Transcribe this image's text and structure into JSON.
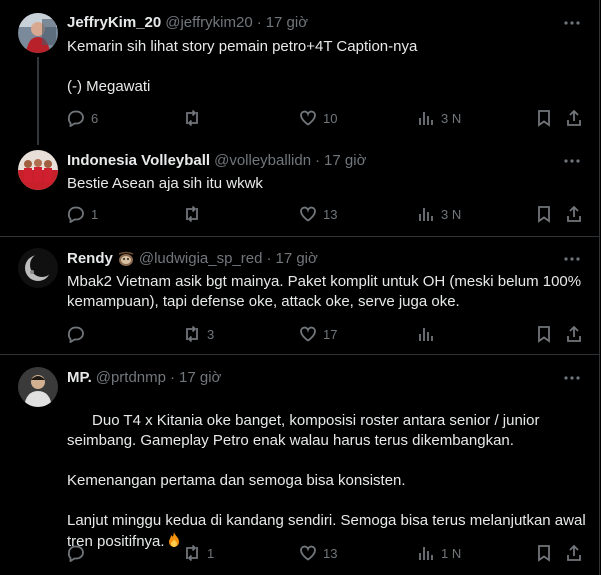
{
  "tweets": [
    {
      "name": "JeffryKim_20",
      "handle": "@jeffrykim20",
      "time": "17 giờ",
      "text": "Kemarin sih lihat story pemain petro+4T Caption-nya\n\n(-) Megawati",
      "replies": "6",
      "reposts": "",
      "likes": "10",
      "views": "3 N"
    },
    {
      "name": "Indonesia Volleyball",
      "handle": "@volleyballidn",
      "time": "17 giờ",
      "text": "Bestie Asean aja sih itu wkwk",
      "replies": "1",
      "reposts": "",
      "likes": "13",
      "views": "3 N"
    },
    {
      "name": "Rendy",
      "handle": "@ludwigia_sp_red",
      "time": "17 giờ",
      "text": "Mbak2 Vietnam asik bgt mainya. Paket komplit untuk OH (meski belum 100% kemampuan), tapi defense oke, attack oke, serve juga oke.",
      "replies": "",
      "reposts": "3",
      "likes": "17",
      "views": ""
    },
    {
      "name": "MP.",
      "handle": "@prtdnmp",
      "time": "17 giờ",
      "text": "Duo T4 x Kitania oke banget, komposisi roster antara senior / junior seimbang. Gameplay Petro enak walau harus terus dikembangkan.\n\nKemenangan pertama dan semoga bisa konsisten.\n\nLanjut minggu kedua di kandang sendiri. Semoga bisa terus melanjutkan awal tren positifnya.",
      "replies": "",
      "reposts": "1",
      "likes": "13",
      "views": "1 N"
    }
  ],
  "icons": [
    "reply-icon",
    "repost-icon",
    "like-icon",
    "views-icon",
    "bookmark-icon",
    "share-icon",
    "more-icon",
    "fire-emoji",
    "sloth-emoji"
  ],
  "colors": {
    "background": "#000000",
    "text": "#e7e9ea",
    "secondary": "#71767b",
    "border": "#2f3336"
  }
}
